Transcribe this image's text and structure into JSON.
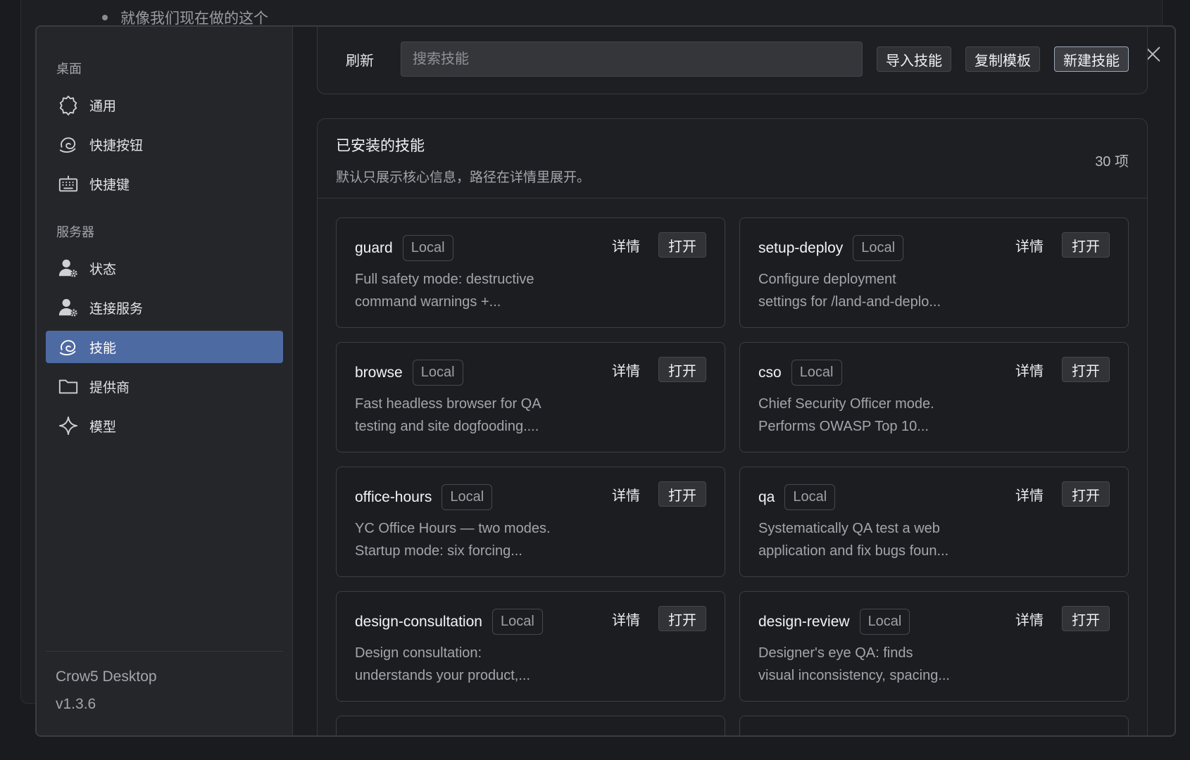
{
  "background": {
    "bullet_text": "就像我们现在做的这个"
  },
  "sidebar": {
    "group_desktop": "桌面",
    "group_server": "服务器",
    "items_desktop": [
      {
        "label": "通用",
        "icon": "gear-icon"
      },
      {
        "label": "快捷按钮",
        "icon": "swirl-icon"
      },
      {
        "label": "快捷键",
        "icon": "keyboard-icon"
      }
    ],
    "items_server": [
      {
        "label": "状态",
        "icon": "user-gear-icon"
      },
      {
        "label": "连接服务",
        "icon": "user-gear-icon"
      },
      {
        "label": "技能",
        "icon": "swirl-icon",
        "active": true
      },
      {
        "label": "提供商",
        "icon": "folder-icon"
      },
      {
        "label": "模型",
        "icon": "sparkle-icon"
      }
    ],
    "app_name": "Crow5 Desktop",
    "version": "v1.3.6"
  },
  "toolbar": {
    "refresh_label": "刷新",
    "search_placeholder": "搜索技能",
    "import_label": "导入技能",
    "copy_template_label": "复制模板",
    "new_label": "新建技能"
  },
  "panel": {
    "title": "已安装的技能",
    "subtitle": "默认只展示核心信息，路径在详情里展开。",
    "count": "30 项"
  },
  "card_labels": {
    "detail": "详情",
    "open": "打开"
  },
  "skills": [
    {
      "name": "guard",
      "source": "Local",
      "desc": "Full safety mode: destructive\ncommand warnings +..."
    },
    {
      "name": "setup-deploy",
      "source": "Local",
      "desc": "Configure deployment\nsettings for /land-and-deplo..."
    },
    {
      "name": "browse",
      "source": "Local",
      "desc": "Fast headless browser for QA\ntesting and site dogfooding...."
    },
    {
      "name": "cso",
      "source": "Local",
      "desc": "Chief Security Officer mode.\nPerforms OWASP Top 10..."
    },
    {
      "name": "office-hours",
      "source": "Local",
      "desc": "YC Office Hours — two modes.\nStartup mode: six forcing..."
    },
    {
      "name": "qa",
      "source": "Local",
      "desc": "Systematically QA test a web\napplication and fix bugs foun..."
    },
    {
      "name": "design-consultation",
      "source": "Local",
      "desc": "Design consultation:\nunderstands your product,..."
    },
    {
      "name": "design-review",
      "source": "Local",
      "desc": "Designer's eye QA: finds\nvisual inconsistency, spacing..."
    }
  ],
  "colors": {
    "accent_active": "#4e6aa3",
    "background": "#1c1d20"
  }
}
